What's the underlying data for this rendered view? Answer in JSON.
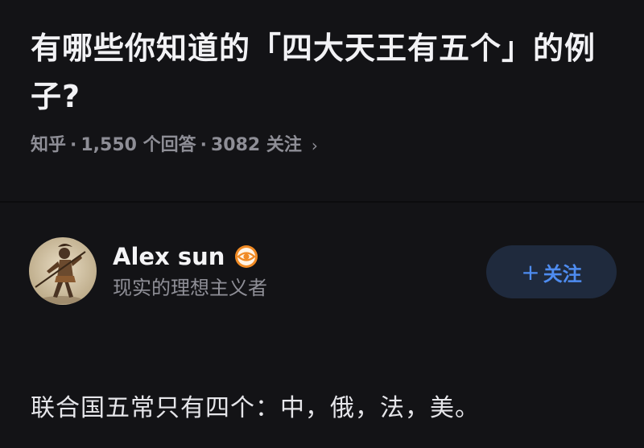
{
  "question": {
    "title": "有哪些你知道的「四大天王有五个」的例子?",
    "source": "知乎",
    "separator": "·",
    "answer_count": "1,550 个回答",
    "follow_count": "3082 关注",
    "chevron_icon": "chevron-right-icon"
  },
  "author": {
    "name": "Alex sun",
    "bio": "现实的理想主义者",
    "badge_icon": "eye-badge-icon",
    "avatar_icon": "warrior-avatar",
    "badge_color": "#f08a24"
  },
  "follow_button": {
    "plus": "+",
    "label": "关注",
    "color": "#4e8cf0"
  },
  "answer": {
    "text": "联合国五常只有四个：中，俄，法，美。"
  }
}
